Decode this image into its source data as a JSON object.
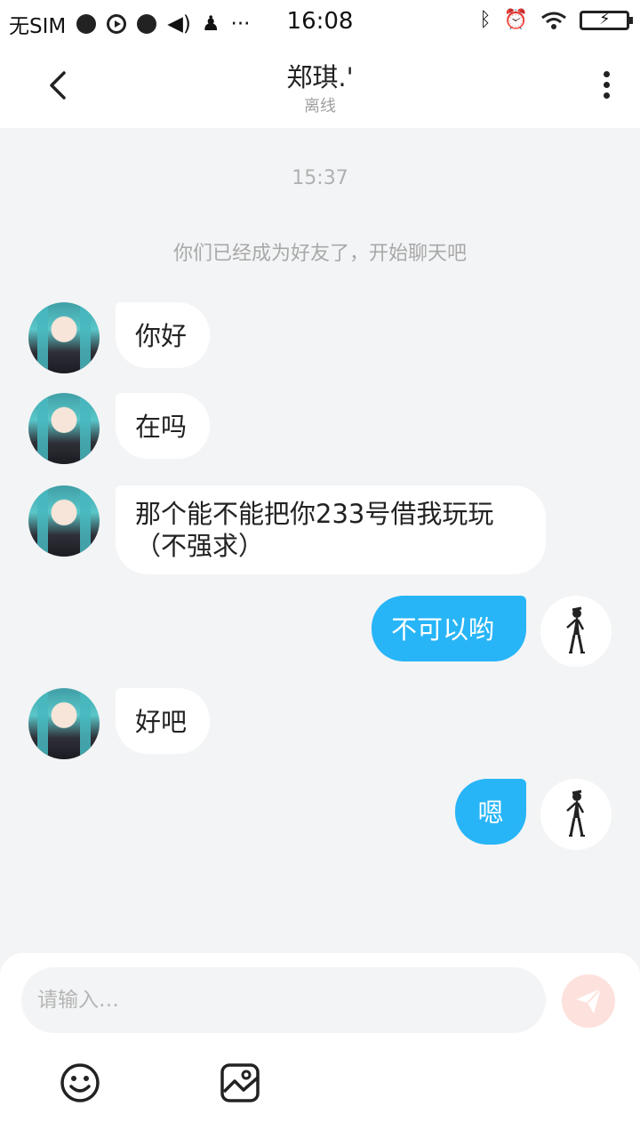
{
  "status_bar": {
    "carrier": "无SIM",
    "time": "16:08",
    "left_icons": [
      "planet-icon",
      "play-icon",
      "sport-icon",
      "speaker-icon",
      "qq-icon",
      "more-dots"
    ],
    "right_icons": [
      "bluetooth-icon",
      "alarm-icon",
      "wifi-icon",
      "battery-icon"
    ]
  },
  "header": {
    "title": "郑琪.'",
    "subtitle": "离线"
  },
  "chat": {
    "timestamp": "15:37",
    "notice": "你们已经成为好友了，开始聊天吧",
    "messages": [
      {
        "from": "other",
        "text": "你好"
      },
      {
        "from": "other",
        "text": "在吗"
      },
      {
        "from": "other",
        "text": "那个能不能把你233号借我玩玩\n（不强求）"
      },
      {
        "from": "me",
        "text": "不可以哟"
      },
      {
        "from": "other",
        "text": "好吧"
      },
      {
        "from": "me",
        "text": "嗯"
      }
    ]
  },
  "input": {
    "placeholder": "请输入…"
  },
  "colors": {
    "accent_blue": "#27b5f7",
    "send_button_disabled": "#fde1dc",
    "background": "#f3f4f5"
  }
}
